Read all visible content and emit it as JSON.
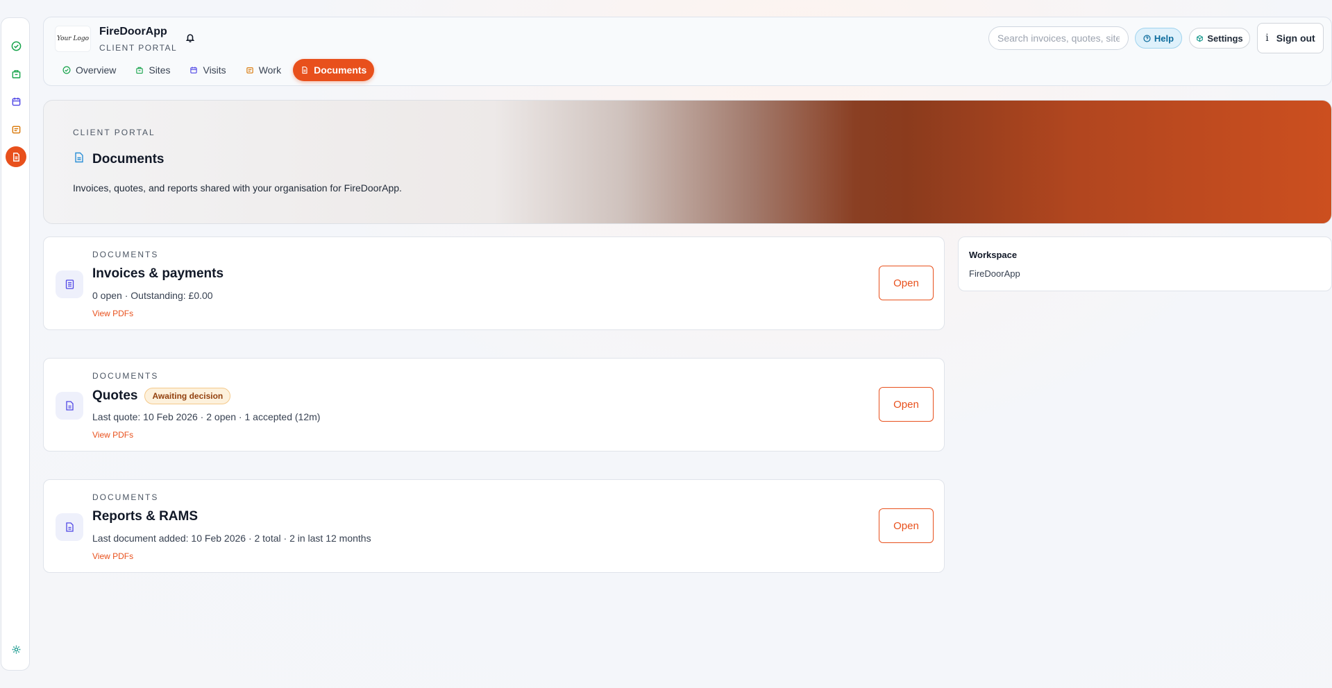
{
  "rail": {
    "items": [
      {
        "name": "overview",
        "icon": "check-circle-icon",
        "color": "#16a34a"
      },
      {
        "name": "sites",
        "icon": "building-icon",
        "color": "#16a34a"
      },
      {
        "name": "visits",
        "icon": "calendar-icon",
        "color": "#4f46e5"
      },
      {
        "name": "work",
        "icon": "clipboard-icon",
        "color": "#d97706"
      },
      {
        "name": "documents",
        "icon": "document-icon",
        "color": "#ffffff",
        "active": true
      }
    ],
    "footer_icon": "settings-gear-icon"
  },
  "header": {
    "logo_text": "Your Logo",
    "brand_name": "FireDoorApp",
    "brand_sub": "CLIENT PORTAL",
    "search_placeholder": "Search invoices, quotes, sites...",
    "help_label": "Help",
    "settings_label": "Settings",
    "signout_label": "Sign out",
    "tabs": [
      {
        "label": "Overview",
        "icon": "check-circle-icon"
      },
      {
        "label": "Sites",
        "icon": "building-icon"
      },
      {
        "label": "Visits",
        "icon": "calendar-icon"
      },
      {
        "label": "Work",
        "icon": "clipboard-icon"
      },
      {
        "label": "Documents",
        "icon": "document-icon",
        "active": true
      }
    ]
  },
  "hero": {
    "eyebrow": "CLIENT PORTAL",
    "title": "Documents",
    "description": "Invoices, quotes, and reports shared with your organisation for FireDoorApp."
  },
  "cards": [
    {
      "eyebrow": "DOCUMENTS",
      "title": "Invoices & payments",
      "badge": "",
      "subtitle": "0 open · Outstanding: £0.00",
      "link": "View PDFs",
      "button": "Open"
    },
    {
      "eyebrow": "DOCUMENTS",
      "title": "Quotes",
      "badge": "Awaiting decision",
      "subtitle": "Last quote: 10 Feb 2026 · 2 open · 1 accepted (12m)",
      "link": "View PDFs",
      "button": "Open"
    },
    {
      "eyebrow": "DOCUMENTS",
      "title": "Reports & RAMS",
      "badge": "",
      "subtitle": "Last document added: 10 Feb 2026 · 2 total · 2 in last 12 months",
      "link": "View PDFs",
      "button": "Open"
    }
  ],
  "workspace": {
    "label": "Workspace",
    "value": "FireDoorApp"
  },
  "colors": {
    "accent": "#e8501c",
    "badge_bg": "#fdf1dc",
    "badge_text": "#92400e"
  }
}
